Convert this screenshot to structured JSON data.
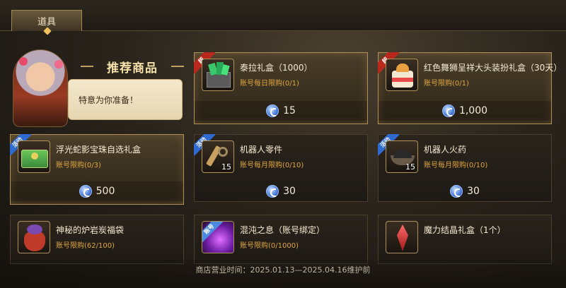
{
  "tab": {
    "label": "道具"
  },
  "featured": {
    "title": "推荐商品",
    "speech": "特意为你准备！"
  },
  "colors": {
    "gold_border": "#b09058",
    "limit_text": "#e0a640",
    "coin": "#4a7ad8"
  },
  "cards": [
    {
      "ribbon": "超",
      "name": "泰拉礼盒（1000）",
      "limit": "账号每日限购(0/1)",
      "price": "15",
      "icon": "green-crystal-chest-icon",
      "qty": ""
    },
    {
      "ribbon": "超",
      "name": "红色舞狮呈祥大头装扮礼盒（30天）",
      "limit": "账号限购(0/1)",
      "price": "1,000",
      "icon": "cake-gift-box-icon",
      "qty": ""
    },
    {
      "ribbon": "活动",
      "name": "浮光蛇影宝珠自选礼盒",
      "limit": "账号限购(0/3)",
      "price": "500",
      "icon": "green-treasure-box-icon",
      "qty": ""
    },
    {
      "ribbon": "活动",
      "name": "机器人零件",
      "limit": "账号每月限购(0/10)",
      "price": "30",
      "icon": "robot-parts-icon",
      "qty": "15"
    },
    {
      "ribbon": "活动",
      "name": "机器人火药",
      "limit": "账号每月限购(0/10)",
      "price": "30",
      "icon": "gunpowder-bowl-icon",
      "qty": "15"
    },
    {
      "ribbon": "",
      "name": "神秘的炉岩炭福袋",
      "limit": "账号限购(62/100)",
      "price": "",
      "icon": "lucky-bag-icon",
      "qty": ""
    },
    {
      "ribbon": "账号",
      "name": "混沌之息（账号绑定）",
      "limit": "账号限购(0/1000)",
      "price": "",
      "icon": "purple-chaos-icon",
      "qty": ""
    },
    {
      "ribbon": "",
      "name": "魔力结晶礼盒（1个）",
      "limit": "",
      "price": "",
      "icon": "red-crystal-icon",
      "qty": ""
    }
  ],
  "footer": {
    "text": "商店营业时间：2025.01.13—2025.04.16维护前"
  }
}
